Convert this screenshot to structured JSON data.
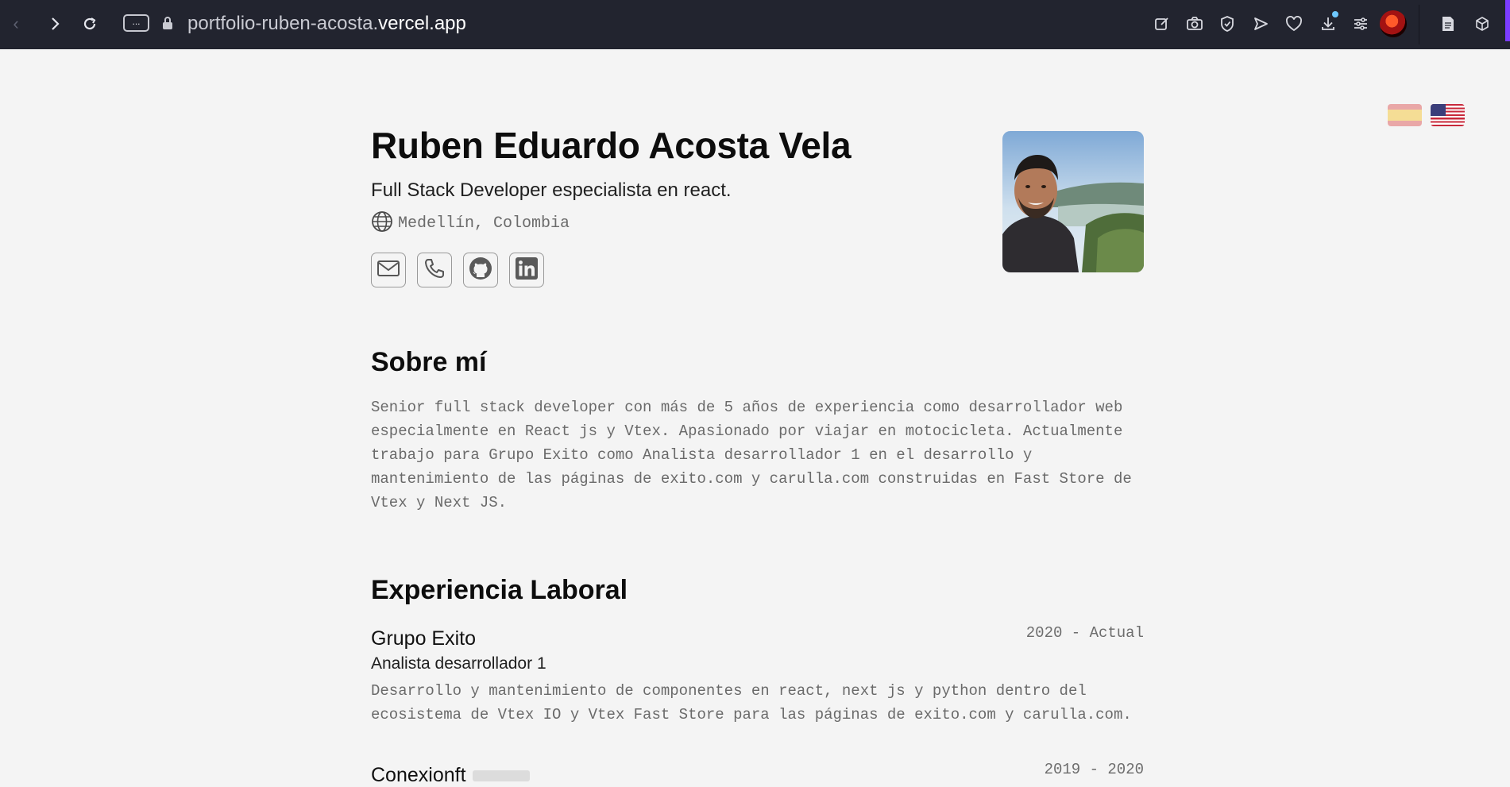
{
  "browser": {
    "url_domain": "portfolio-ruben-acosta.",
    "url_tld": "vercel.app",
    "tabs_button_label": "...",
    "icons": [
      "edit-icon",
      "camera-icon",
      "shield-icon",
      "send-icon",
      "heart-icon",
      "download-icon",
      "settings-sliders-icon",
      "profile-avatar",
      "page-icon",
      "cube-icon"
    ]
  },
  "language_flags": [
    "spain-flag-icon",
    "usa-flag-icon"
  ],
  "header": {
    "name": "Ruben Eduardo Acosta Vela",
    "subtitle": "Full Stack Developer especialista en react.",
    "location": "Medellín, Colombia",
    "social": [
      "mail-icon",
      "phone-icon",
      "github-icon",
      "linkedin-icon"
    ]
  },
  "about": {
    "title": "Sobre mí",
    "text": "Senior full stack developer con más de 5 años de experiencia como desarrollador web especialmente en React js y Vtex. Apasionado por viajar en motocicleta. Actualmente trabajo para Grupo Exito como Analista desarrollador 1 en el desarrollo y mantenimiento de las páginas de exito.com y carulla.com construidas en Fast Store de Vtex y Next JS."
  },
  "experience": {
    "title": "Experiencia Laboral",
    "jobs": [
      {
        "company": "Grupo Exito",
        "role": "Analista desarrollador 1",
        "dates": "2020 - Actual",
        "description": "Desarrollo y mantenimiento de componentes en react, next js y python dentro del ecosistema de Vtex IO y Vtex Fast Store para las páginas de exito.com y carulla.com."
      },
      {
        "company": "Conexionft",
        "dates": "2019 - 2020"
      }
    ]
  }
}
